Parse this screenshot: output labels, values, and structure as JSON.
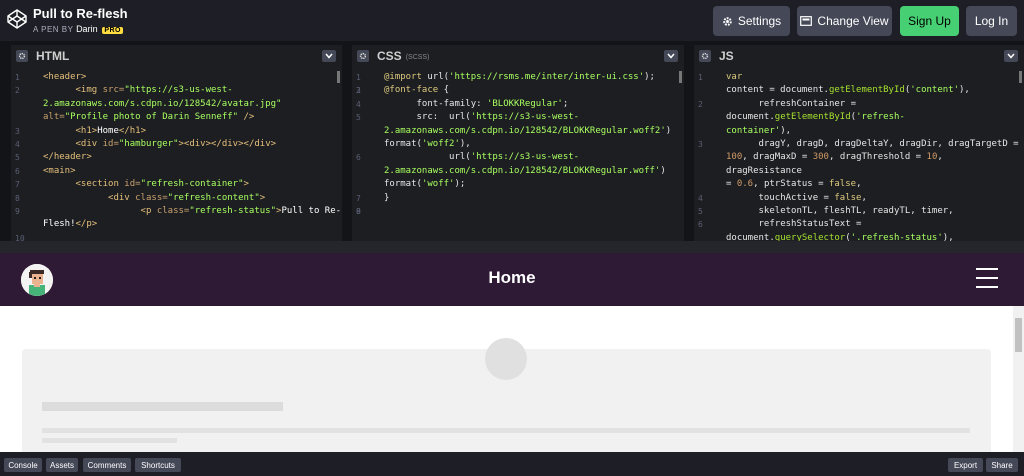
{
  "topbar": {
    "pen_title": "Pull to Re-flesh",
    "pen_meta_prefix": "A PEN BY",
    "author": "Darin",
    "pro_badge": "PRO",
    "settings_label": "Settings",
    "change_view_label": "Change View",
    "signup_label": "Sign Up",
    "login_label": "Log In"
  },
  "editors": {
    "html": {
      "title": "HTML",
      "subtitle": ""
    },
    "css": {
      "title": "CSS",
      "subtitle": "(SCSS)"
    },
    "js": {
      "title": "JS",
      "subtitle": ""
    }
  },
  "preview": {
    "title": "Home"
  },
  "bottombar": {
    "console": "Console",
    "assets": "Assets",
    "comments": "Comments",
    "shortcuts": "Shortcuts",
    "export": "Export",
    "share": "Share"
  },
  "colors": {
    "signup_green": "#47cf73",
    "preview_header": "#2f1a35",
    "pro_yellow": "#ffdd40"
  }
}
